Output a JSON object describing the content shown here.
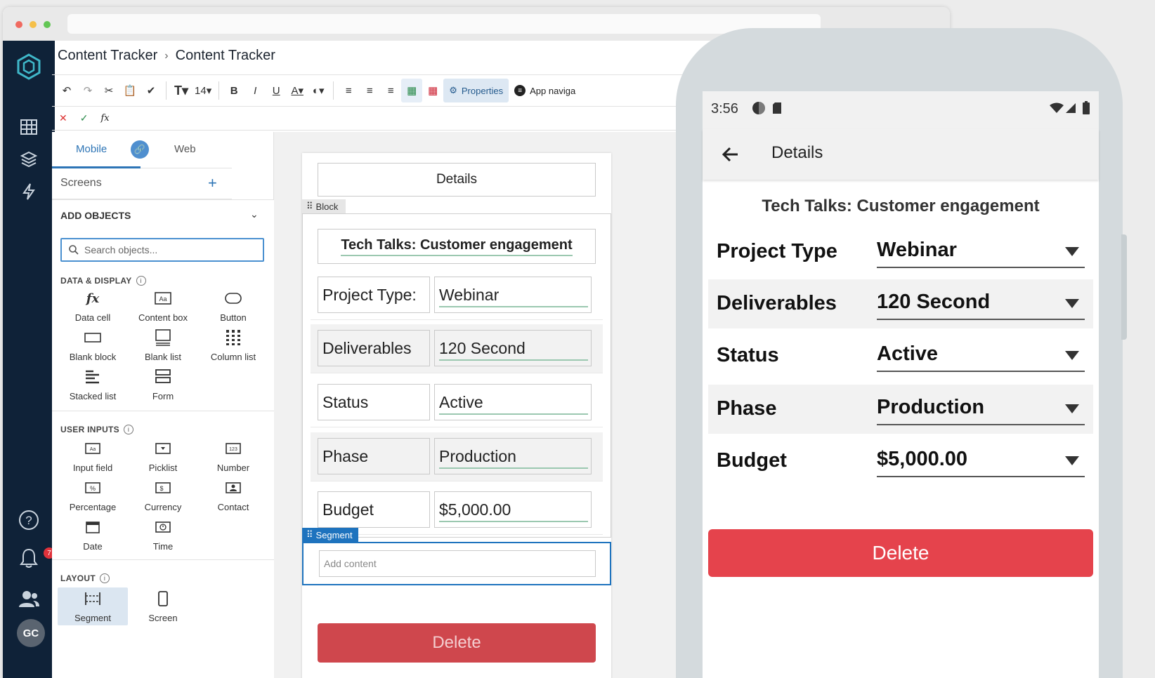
{
  "breadcrumb": {
    "parent": "Content Tracker",
    "current": "Content Tracker"
  },
  "toolbar": {
    "font_size": "14",
    "properties_label": "Properties",
    "app_nav_label": "App naviga"
  },
  "formula_bar": {
    "fx": "fx"
  },
  "nav": {
    "notification_count": "7",
    "avatar_initials": "GC"
  },
  "panel": {
    "tabs": {
      "mobile": "Mobile",
      "web": "Web"
    },
    "screens_label": "Screens",
    "add_objects": "ADD OBJECTS",
    "search_placeholder": "Search objects...",
    "sections": {
      "data_display": "DATA & DISPLAY",
      "user_inputs": "USER INPUTS",
      "layout": "LAYOUT"
    },
    "data_display_items": [
      "Data cell",
      "Content box",
      "Button",
      "Blank block",
      "Blank list",
      "Column list",
      "Stacked list",
      "Form"
    ],
    "user_input_items": [
      "Input field",
      "Picklist",
      "Number",
      "Percentage",
      "Currency",
      "Contact",
      "Date",
      "Time"
    ],
    "layout_items": [
      "Segment",
      "Screen"
    ]
  },
  "canvas": {
    "screen_title": "Details",
    "block_tag": "Block",
    "heading": "Tech Talks: Customer engagement",
    "rows": [
      {
        "label": "Project Type:",
        "value": "Webinar"
      },
      {
        "label": "Deliverables",
        "value": "120 Second"
      },
      {
        "label": "Status",
        "value": "Active"
      },
      {
        "label": "Phase",
        "value": "Production"
      },
      {
        "label": "Budget",
        "value": "$5,000.00"
      }
    ],
    "segment_tag": "Segment",
    "add_content_placeholder": "Add content",
    "delete_label": "Delete"
  },
  "phone": {
    "time": "3:56",
    "title": "Details",
    "heading": "Tech Talks: Customer engagement",
    "rows": [
      {
        "label": "Project Type",
        "value": "Webinar"
      },
      {
        "label": "Deliverables",
        "value": "120 Second"
      },
      {
        "label": "Status",
        "value": "Active"
      },
      {
        "label": "Phase",
        "value": "Production"
      },
      {
        "label": "Budget",
        "value": "$5,000.00"
      }
    ],
    "delete_label": "Delete"
  },
  "colors": {
    "nav_bg": "#0f2238",
    "accent": "#2e75b6",
    "delete": "#e5434c",
    "segment": "#1e73be"
  }
}
